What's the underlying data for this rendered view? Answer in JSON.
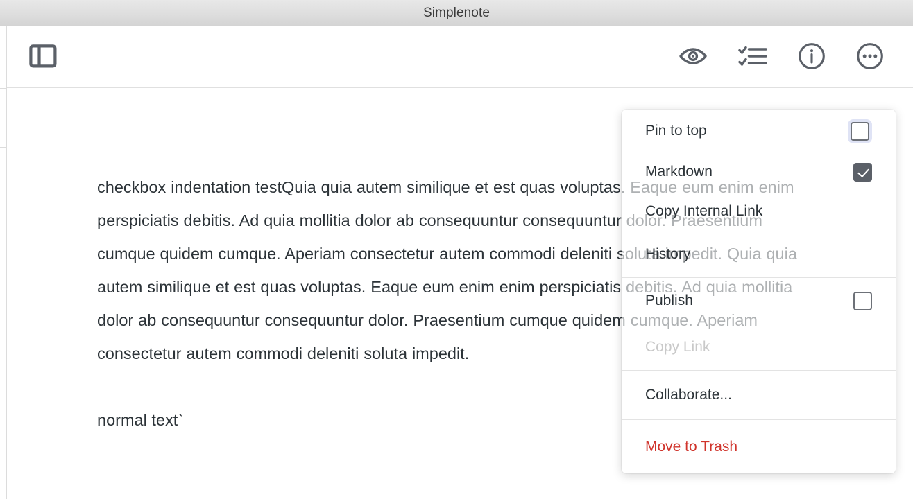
{
  "window": {
    "title": "Simplenote"
  },
  "toolbar": {
    "sidebar_toggle": "sidebar-toggle-icon",
    "preview": "eye-icon",
    "checklist": "checklist-icon",
    "info": "info-circle-icon",
    "more": "ellipsis-circle-icon"
  },
  "note": {
    "paragraph": "checkbox indentation testQuia quia autem similique et est quas voluptas. Eaque eum enim enim perspiciatis debitis. Ad quia mollitia dolor ab consequuntur consequuntur dolor. Praesentium cumque quidem cumque. Aperiam consectetur autem commodi deleniti soluta impedit. Quia quia autem similique et est quas voluptas. Eaque eum enim enim perspiciatis debitis. Ad quia mollitia dolor ab consequuntur consequuntur dolor. Praesentium cumque quidem cumque. Aperiam consectetur autem commodi deleniti soluta impedit.",
    "trailing_line": "normal text`"
  },
  "menu": {
    "items": [
      {
        "label": "Pin to top",
        "checked": false,
        "focused": true
      },
      {
        "label": "Markdown",
        "checked": true
      },
      {
        "label": "Copy Internal Link"
      },
      {
        "label": "History"
      },
      {
        "label": "Publish",
        "checked": false
      },
      {
        "label": "Copy Link",
        "disabled": true
      },
      {
        "label": "Collaborate..."
      },
      {
        "label": "Move to Trash",
        "danger": true
      }
    ],
    "labels": {
      "pin_to_top": "Pin to top",
      "markdown": "Markdown",
      "copy_internal_link": "Copy Internal Link",
      "history": "History",
      "publish": "Publish",
      "copy_link": "Copy Link",
      "collaborate": "Collaborate...",
      "move_to_trash": "Move to Trash"
    }
  },
  "colors": {
    "text": "#2c3338",
    "icon": "#5b6068",
    "danger": "#d0342c",
    "disabled": "#c9c9c9",
    "checkbox_checked": "#5b6068",
    "focus_ring": "#dfe3f5"
  }
}
